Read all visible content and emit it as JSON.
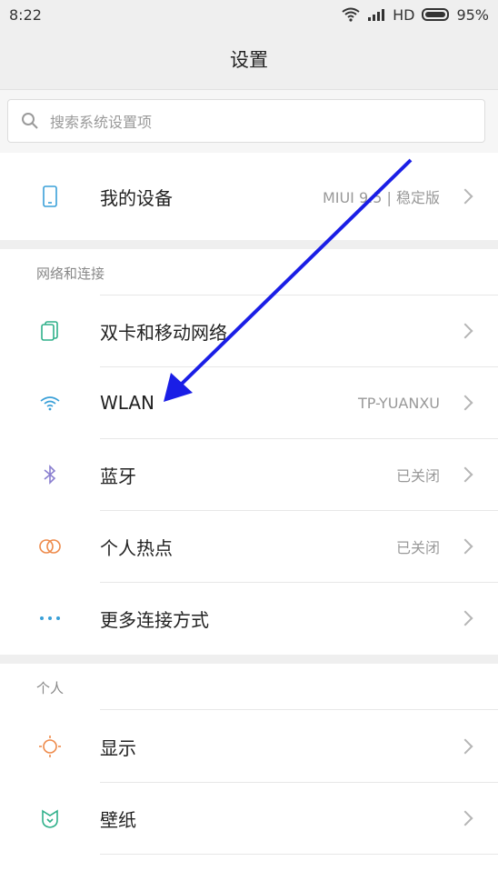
{
  "status": {
    "time": "8:22",
    "network": "HD",
    "battery": "95%"
  },
  "title": "设置",
  "search": {
    "placeholder": "搜索系统设置项"
  },
  "device": {
    "label": "我的设备",
    "value": "MIUI 9.5 | 稳定版"
  },
  "network_section": {
    "header": "网络和连接",
    "items": [
      {
        "label": "双卡和移动网络",
        "value": ""
      },
      {
        "label": "WLAN",
        "value": "TP-YUANXU"
      },
      {
        "label": "蓝牙",
        "value": "已关闭"
      },
      {
        "label": "个人热点",
        "value": "已关闭"
      },
      {
        "label": "更多连接方式",
        "value": ""
      }
    ]
  },
  "personal_section": {
    "header": "个人",
    "items": [
      {
        "label": "显示"
      },
      {
        "label": "壁纸"
      }
    ]
  },
  "colors": {
    "accent_blue": "#3aa0d8",
    "bluetooth": "#8a7fd0",
    "hotspot": "#ee8a4a",
    "display": "#ee8a4a",
    "wallpaper": "#2fb08a",
    "annotation_arrow": "#1a1ee6"
  },
  "icons": [
    "phone-icon",
    "sim-card-icon",
    "wifi-icon",
    "bluetooth-icon",
    "hotspot-icon",
    "more-dots-icon",
    "sun-icon",
    "wallpaper-icon",
    "search-icon",
    "chevron-right-icon"
  ]
}
